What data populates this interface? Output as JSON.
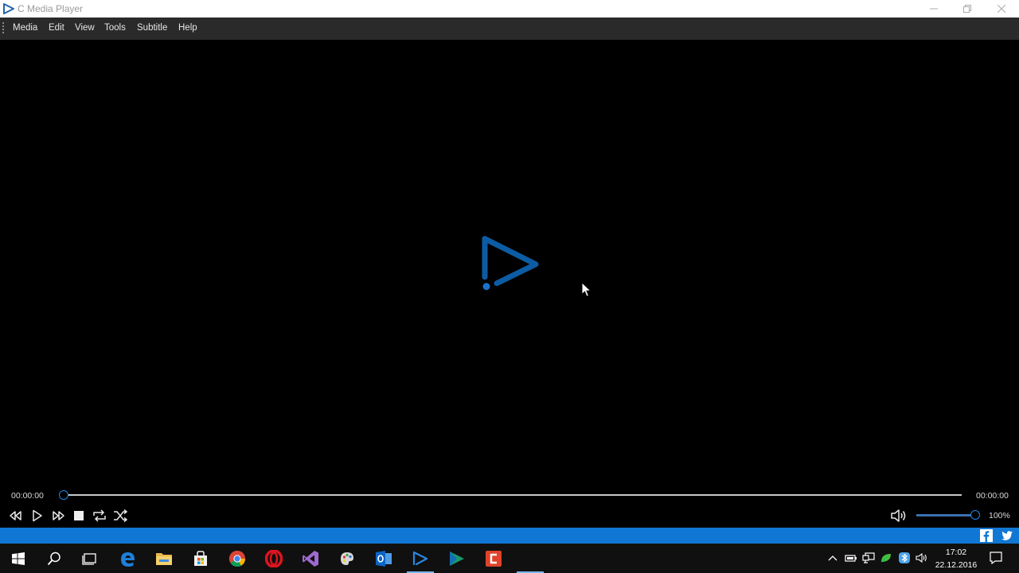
{
  "window": {
    "title": "C Media Player"
  },
  "menu": {
    "items": [
      "Media",
      "Edit",
      "View",
      "Tools",
      "Subtitle",
      "Help"
    ]
  },
  "player": {
    "current_time": "00:00:00",
    "total_time": "00:00:00",
    "position_fraction": 0,
    "volume_label": "100%",
    "volume_fraction": 1.0,
    "controls": [
      "rewind-icon",
      "play-icon",
      "fast-forward-icon",
      "stop-icon",
      "repeat-icon",
      "shuffle-icon"
    ]
  },
  "social": [
    "facebook-icon",
    "twitter-icon"
  ],
  "taskbar": {
    "apps": [
      "start-icon",
      "search-icon",
      "task-view-icon",
      "edge-icon",
      "file-explorer-icon",
      "store-icon",
      "chrome-icon",
      "opera-icon",
      "visual-studio-icon",
      "paint-icon",
      "outlook-icon",
      "c-media-player-icon",
      "media-app-icon",
      "app-icon"
    ],
    "time": "17:02",
    "date": "22.12.2016"
  },
  "colors": {
    "accent": "#1177d4",
    "logo_blue": "#0d5ca3",
    "menubar": "#2a2a2a"
  }
}
